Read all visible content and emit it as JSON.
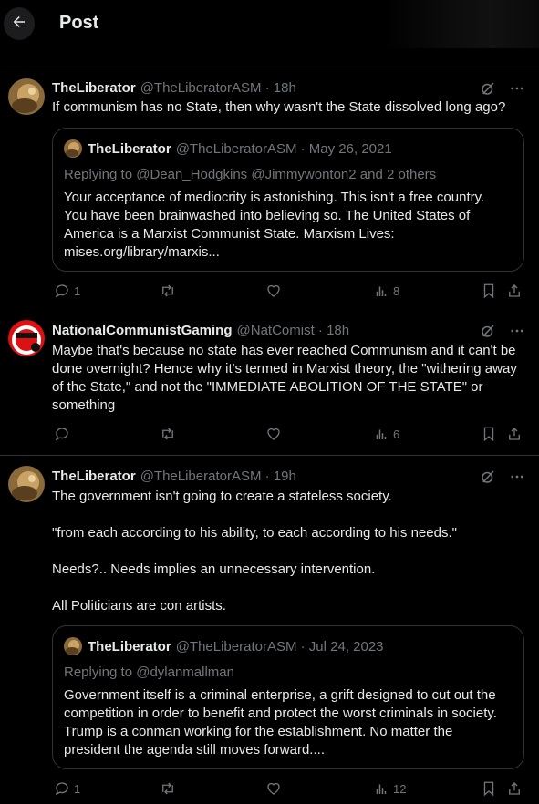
{
  "header": {
    "title": "Post"
  },
  "posts": [
    {
      "name": "TheLiberator",
      "handle": "@TheLiberatorASM · 18h",
      "text": "If communism has no State, then why wasn't the State dissolved long ago?",
      "quote": {
        "name": "TheLiberator",
        "handle": "@TheLiberatorASM · May 26, 2021",
        "reply": "Replying to @Dean_Hodgkins @Jimmywonton2 and 2 others",
        "text": "Your acceptance of mediocrity is astonishing. This isn't a free country. You have been brainwashed into believing so. The United States of America is a Marxist Communist State. Marxism Lives: mises.org/library/marxis..."
      },
      "replies": "1",
      "views": "8"
    },
    {
      "name": "NationalCommunistGaming",
      "handle": "@NatComist · 18h",
      "text": "Maybe that's because no state has ever reached Communism and it can't be done overnight? Hence why it's termed in Marxist theory, the \"withering away of the State,\" and not the \"IMMEDIATE ABOLITION OF THE STATE\" or something",
      "views": "6"
    },
    {
      "name": "TheLiberator",
      "handle": "@TheLiberatorASM · 19h",
      "text": "The government isn't going to create a stateless society.\n\n\"from each according to his ability, to each according to his needs.\"\n\nNeeds?.. Needs implies an unnecessary intervention.\n\nAll Politicians are con artists.",
      "quote": {
        "name": "TheLiberator",
        "handle": "@TheLiberatorASM · Jul 24, 2023",
        "reply": "Replying to @dylanmallman",
        "text": "Government itself is a criminal enterprise, a grift designed to cut out the competition in order to benefit and protect the worst criminals in society. Trump is a conman working for the establishment. No matter the president the agenda still moves forward...."
      },
      "replies": "1",
      "views": "12"
    }
  ]
}
